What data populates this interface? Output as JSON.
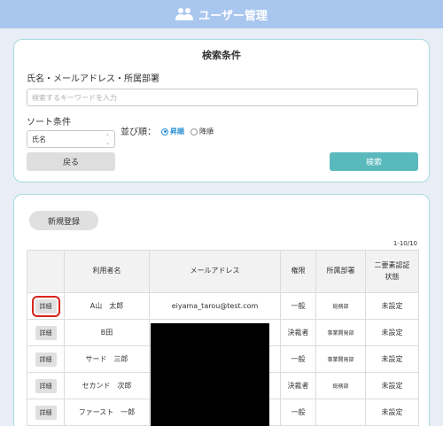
{
  "header": {
    "title": "ユーザー管理",
    "icon": "users-icon"
  },
  "search": {
    "title": "検索条件",
    "keyword_label": "氏名・メールアドレス・所属部署",
    "keyword_placeholder": "検索するキーワードを入力",
    "sort_label": "ソート条件",
    "sort_value": "氏名",
    "order_label": "並び順：",
    "order_options": [
      {
        "label": "昇順",
        "checked": true
      },
      {
        "label": "降順",
        "checked": false
      }
    ],
    "back_label": "戻る",
    "search_label": "検索"
  },
  "list": {
    "new_label": "新規登録",
    "count": "1-10/10",
    "columns": [
      "",
      "利用者名",
      "メールアドレス",
      "権限",
      "所属部署",
      "二要素認証\n状態"
    ],
    "rows": [
      {
        "detail": "詳細",
        "name": "A山　太郎",
        "email": "eiyama_tarou@test.com",
        "role": "一般",
        "dept": "総務部",
        "mfa": "未設定"
      },
      {
        "detail": "詳細",
        "name": "B田",
        "email": "",
        "role": "決裁者",
        "dept": "事業開発部",
        "mfa": "未設定"
      },
      {
        "detail": "詳細",
        "name": "サード　三郎",
        "email": "",
        "role": "一般",
        "dept": "事業開発部",
        "mfa": "未設定"
      },
      {
        "detail": "詳細",
        "name": "セカンド　次郎",
        "email": "",
        "role": "決裁者",
        "dept": "総務部",
        "mfa": "未設定"
      },
      {
        "detail": "詳細",
        "name": "ファースト　一郎",
        "email": "",
        "role": "一般",
        "dept": "",
        "mfa": "未設定"
      }
    ]
  },
  "colors": {
    "header": "#a9c6ef",
    "accent": "#5ab9bd",
    "radio": "#2a8fd4",
    "highlight": "#d8241c"
  }
}
